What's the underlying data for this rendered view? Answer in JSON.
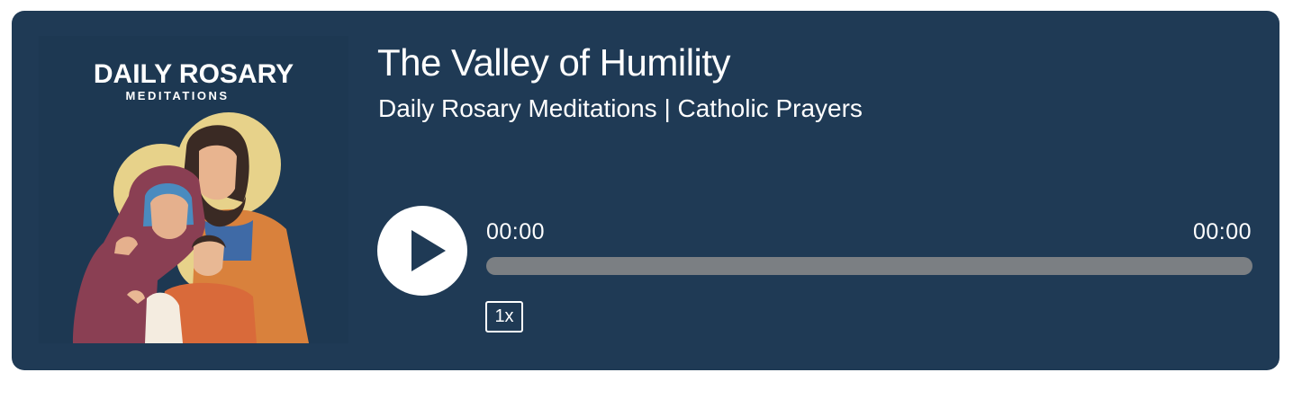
{
  "episode": {
    "title": "The Valley of Humility",
    "podcast": "Daily Rosary Meditations | Catholic Prayers"
  },
  "cover_art": {
    "brand_line_1": "DAILY ROSARY",
    "brand_line_2": "MEDITATIONS",
    "description": "Icon of the Holy Family"
  },
  "player": {
    "current_time": "00:00",
    "total_time": "00:00",
    "progress": 0,
    "speed": "1x",
    "play_icon": "play-icon"
  },
  "colors": {
    "background": "#1f3a55",
    "text": "#ffffff",
    "progress_track": "#7b7f83",
    "play_button": "#ffffff",
    "play_triangle": "#1f3a55"
  }
}
